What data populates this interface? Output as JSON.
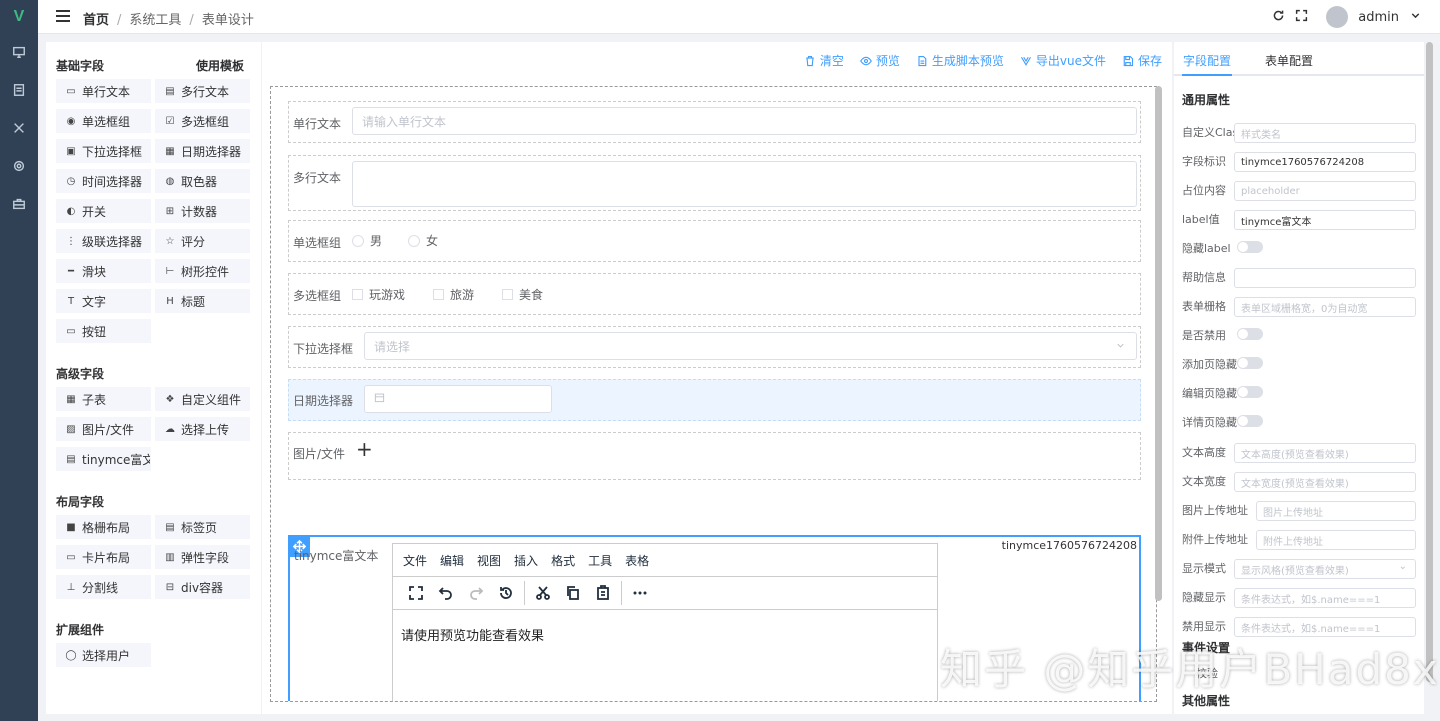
{
  "header": {
    "crumbs": [
      "首页",
      "系统工具",
      "表单设计"
    ],
    "sep": "/",
    "user": "admin"
  },
  "palette": {
    "sections": {
      "basic": "基础字段",
      "template": "使用模板",
      "advanced": "高级字段",
      "layout": "布局字段",
      "ext": "扩展组件"
    },
    "basic": [
      {
        "label": "单行文本",
        "icon": "input-icon"
      },
      {
        "label": "多行文本",
        "icon": "textarea-icon"
      },
      {
        "label": "单选框组",
        "icon": "radio-icon"
      },
      {
        "label": "多选框组",
        "icon": "checkbox-icon"
      },
      {
        "label": "下拉选择框",
        "icon": "select-icon"
      },
      {
        "label": "日期选择器",
        "icon": "date-icon"
      },
      {
        "label": "时间选择器",
        "icon": "time-icon"
      },
      {
        "label": "取色器",
        "icon": "color-icon"
      },
      {
        "label": "开关",
        "icon": "switch-icon"
      },
      {
        "label": "计数器",
        "icon": "number-icon"
      },
      {
        "label": "级联选择器",
        "icon": "cascader-icon"
      },
      {
        "label": "评分",
        "icon": "star-icon"
      },
      {
        "label": "滑块",
        "icon": "slider-icon"
      },
      {
        "label": "树形控件",
        "icon": "tree-icon"
      },
      {
        "label": "文字",
        "icon": "text-icon"
      },
      {
        "label": "标题",
        "icon": "heading-icon"
      },
      {
        "label": "按钮",
        "icon": "button-icon"
      }
    ],
    "advanced": [
      {
        "label": "子表",
        "icon": "table-icon"
      },
      {
        "label": "自定义组件",
        "icon": "custom-icon"
      },
      {
        "label": "图片/文件",
        "icon": "image-icon"
      },
      {
        "label": "选择上传",
        "icon": "upload-icon"
      },
      {
        "label": "tinymce富文本",
        "icon": "richtext-icon"
      }
    ],
    "layout": [
      {
        "label": "格栅布局",
        "icon": "grid-icon"
      },
      {
        "label": "标签页",
        "icon": "tabs-icon"
      },
      {
        "label": "卡片布局",
        "icon": "card-icon"
      },
      {
        "label": "弹性字段",
        "icon": "flex-icon"
      },
      {
        "label": "分割线",
        "icon": "divider-icon"
      },
      {
        "label": "div容器",
        "icon": "div-icon"
      }
    ],
    "ext": [
      {
        "label": "选择用户",
        "icon": "user-icon"
      }
    ]
  },
  "toolbar": {
    "clear": "清空",
    "preview": "预览",
    "script_preview": "生成脚本预览",
    "export": "导出vue文件",
    "save": "保存"
  },
  "form": {
    "input": {
      "label": "单行文本",
      "placeholder": "请输入单行文本"
    },
    "textarea": {
      "label": "多行文本"
    },
    "radio": {
      "label": "单选框组",
      "options": [
        "男",
        "女"
      ]
    },
    "checkbox": {
      "label": "多选框组",
      "options": [
        "玩游戏",
        "旅游",
        "美食"
      ]
    },
    "select": {
      "label": "下拉选择框",
      "placeholder": "请选择"
    },
    "date": {
      "label": "日期选择器"
    },
    "upload": {
      "label": "图片/文件",
      "plus": "+"
    },
    "tinymce": {
      "label": "tinymce富文本",
      "tag": "tinymce1760576724208",
      "menus": [
        "文件",
        "编辑",
        "视图",
        "插入",
        "格式",
        "工具",
        "表格"
      ],
      "content": "请使用预览功能查看效果"
    }
  },
  "props": {
    "tabs": [
      "字段配置",
      "表单配置"
    ],
    "sections": {
      "common": "通用属性",
      "event": "事件设置",
      "other": "其他属性"
    },
    "rows": {
      "cls": {
        "label": "自定义Class",
        "placeholder": "样式类名"
      },
      "field": {
        "label": "字段标识",
        "value": "tinymce1760576724208"
      },
      "ph": {
        "label": "占位内容",
        "placeholder": "placeholder"
      },
      "lbl": {
        "label": "label值",
        "value": "tinymce富文本"
      },
      "hidelabel": {
        "label": "隐藏label"
      },
      "help": {
        "label": "帮助信息"
      },
      "grid": {
        "label": "表单栅格",
        "placeholder": "表单区域栅格宽，0为自动宽"
      },
      "disabled": {
        "label": "是否禁用"
      },
      "addhide": {
        "label": "添加页隐藏"
      },
      "edithide": {
        "label": "编辑页隐藏"
      },
      "detailhide": {
        "label": "详情页隐藏"
      },
      "height": {
        "label": "文本高度",
        "placeholder": "文本高度(预览查看效果)"
      },
      "width": {
        "label": "文本宽度",
        "placeholder": "文本宽度(预览查看效果)"
      },
      "imgurl": {
        "label": "图片上传地址",
        "placeholder": "图片上传地址"
      },
      "fileurl": {
        "label": "附件上传地址",
        "placeholder": "附件上传地址"
      },
      "mode": {
        "label": "显示模式",
        "placeholder": "显示风格(预览查看效果)"
      },
      "hideshow": {
        "label": "隐藏显示",
        "placeholder": "条件表达式，如$.name===1"
      },
      "disableshow": {
        "label": "禁用显示",
        "placeholder": "条件表达式，如$.name===1"
      },
      "partial": {
        "label": "校验"
      }
    }
  },
  "watermark": "知乎 @知乎用户BHad8x",
  "colors": {
    "primary": "#409eff",
    "rail": "#304156"
  }
}
